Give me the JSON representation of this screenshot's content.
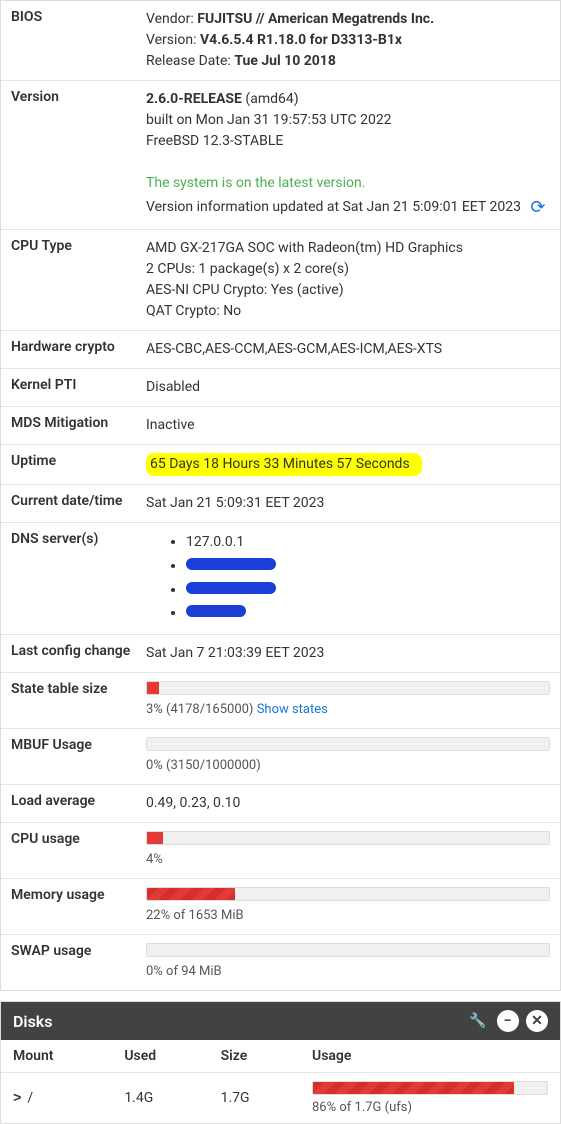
{
  "rows": {
    "bios": {
      "label": "BIOS",
      "vendor_lbl": "Vendor:",
      "vendor": "FUJITSU // American Megatrends Inc.",
      "version_lbl": "Version:",
      "version": "V4.6.5.4 R1.18.0 for D3313-B1x",
      "release_lbl": "Release Date:",
      "release": "Tue Jul 10 2018"
    },
    "version": {
      "label": "Version",
      "main": "2.6.0-RELEASE",
      "arch": "(amd64)",
      "built": "built on Mon Jan 31 19:57:53 UTC 2022",
      "os": "FreeBSD 12.3-STABLE",
      "status": "The system is on the latest version.",
      "updated": "Version information updated at Sat Jan 21 5:09:01 EET 2023"
    },
    "cpu": {
      "label": "CPU Type",
      "name": "AMD GX-217GA SOC with Radeon(tm) HD Graphics",
      "count": "2 CPUs: 1 package(s) x 2 core(s)",
      "aesni": "AES-NI CPU Crypto: Yes (active)",
      "qat": "QAT Crypto: No"
    },
    "hwcrypto": {
      "label": "Hardware crypto",
      "value": "AES-CBC,AES-CCM,AES-GCM,AES-ICM,AES-XTS"
    },
    "pti": {
      "label": "Kernel PTI",
      "value": "Disabled"
    },
    "mds": {
      "label": "MDS Mitigation",
      "value": "Inactive"
    },
    "uptime": {
      "label": "Uptime",
      "value": "65 Days 18 Hours 33 Minutes 57 Seconds"
    },
    "datetime": {
      "label": "Current date/time",
      "value": "Sat Jan 21 5:09:31 EET 2023"
    },
    "dns": {
      "label": "DNS server(s)",
      "items": [
        "127.0.0.1",
        "",
        "",
        ""
      ]
    },
    "lastcfg": {
      "label": "Last config change",
      "value": "Sat Jan 7 21:03:39 EET 2023"
    },
    "states": {
      "label": "State table size",
      "pct": 3,
      "caption": "3% (4178/165000)",
      "link": "Show states"
    },
    "mbuf": {
      "label": "MBUF Usage",
      "pct": 0,
      "caption": "0% (3150/1000000)"
    },
    "load": {
      "label": "Load average",
      "value": "0.49, 0.23, 0.10"
    },
    "cpuusage": {
      "label": "CPU usage",
      "pct": 4,
      "caption": "4%"
    },
    "mem": {
      "label": "Memory usage",
      "pct": 22,
      "caption": "22% of 1653 MiB"
    },
    "swap": {
      "label": "SWAP usage",
      "pct": 0,
      "caption": "0% of 94 MiB"
    }
  },
  "disks": {
    "title": "Disks",
    "headers": {
      "mount": "Mount",
      "used": "Used",
      "size": "Size",
      "usage": "Usage"
    },
    "row": {
      "mount": "/",
      "used": "1.4G",
      "size": "1.7G",
      "pct": 86,
      "caption": "86% of 1.7G (ufs)"
    }
  }
}
